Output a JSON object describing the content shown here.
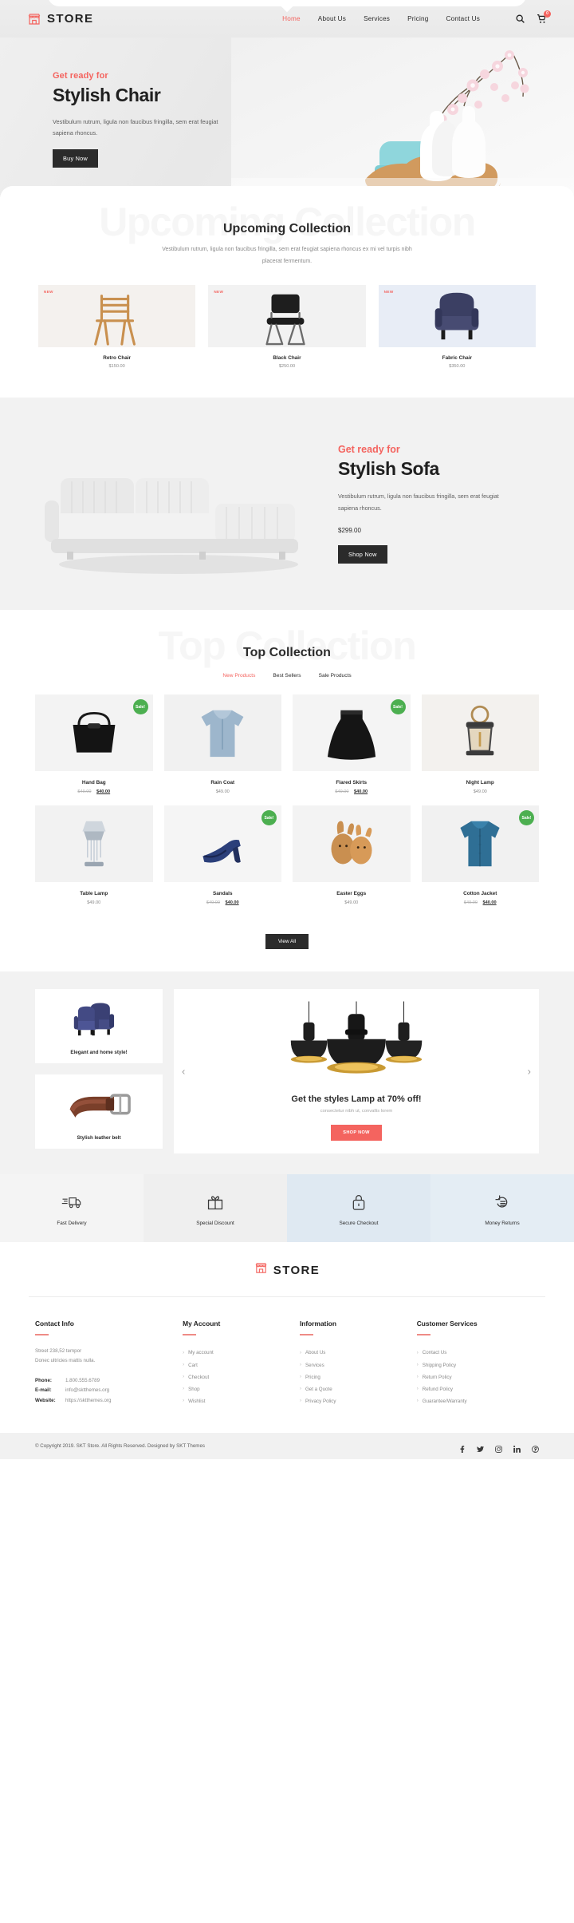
{
  "header": {
    "brand": "STORE",
    "brand_icon": "storefront-icon",
    "nav": [
      {
        "label": "Home",
        "active": true
      },
      {
        "label": "About Us",
        "active": false
      },
      {
        "label": "Services",
        "active": false
      },
      {
        "label": "Pricing",
        "active": false
      },
      {
        "label": "Contact Us",
        "active": false
      }
    ],
    "search_icon": "search-icon",
    "cart_icon": "cart-icon",
    "cart_count": "0"
  },
  "hero": {
    "eyebrow": "Get ready for",
    "title": "Stylish Chair",
    "description": "Vestibulum rutrum, ligula non faucibus fringilla, sem erat feugiat sapiena rhoncus.",
    "button": "Buy Now"
  },
  "upcoming": {
    "ghost_title": "Upcoming Collection",
    "title": "Upcoming Collection",
    "description": "Vestibulum rutrum, ligula non faucibus fringilla, sem erat feugiat sapiena rhoncus ex mi vel turpis nibh placerat fermentum.",
    "badge": "NEW",
    "products": [
      {
        "name": "Retro Chair",
        "price": "$150.00",
        "bg": "#f4f1ee"
      },
      {
        "name": "Black Chair",
        "price": "$250.00",
        "bg": "#f2f2f2"
      },
      {
        "name": "Fabric Chair",
        "price": "$350.00",
        "bg": "#e8edf6"
      }
    ]
  },
  "sofa": {
    "eyebrow": "Get ready for",
    "title": "Stylish Sofa",
    "description": "Vestibulum rutrum, ligula non faucibus fringilla, sem erat feugiat sapiena rhoncus.",
    "price": "$299.00",
    "button": "Shop Now"
  },
  "top_collection": {
    "ghost_title": "Top Collection",
    "title": "Top Collection",
    "tabs": [
      {
        "label": "New Products",
        "active": true
      },
      {
        "label": "Best Sellers",
        "active": false
      },
      {
        "label": "Sale Products",
        "active": false
      }
    ],
    "sale_badge": "Sale!",
    "products": [
      {
        "name": "Hand Bag",
        "old_price": "$49.00",
        "price": "$40.00",
        "sale": true,
        "art": "handbag"
      },
      {
        "name": "Rain Coat",
        "old_price": "",
        "price": "$49.00",
        "sale": false,
        "art": "raincoat"
      },
      {
        "name": "Flared Skirts",
        "old_price": "$49.00",
        "price": "$40.00",
        "sale": true,
        "art": "skirt"
      },
      {
        "name": "Night Lamp",
        "old_price": "",
        "price": "$49.00",
        "sale": false,
        "art": "lantern"
      },
      {
        "name": "Table Lamp",
        "old_price": "",
        "price": "$49.00",
        "sale": false,
        "art": "tablelamp"
      },
      {
        "name": "Sandals",
        "old_price": "$49.00",
        "price": "$40.00",
        "sale": true,
        "art": "sandal"
      },
      {
        "name": "Easter Eggs",
        "old_price": "",
        "price": "$49.00",
        "sale": false,
        "art": "eggs"
      },
      {
        "name": "Cotton Jacket",
        "old_price": "$49.00",
        "price": "$40.00",
        "sale": true,
        "art": "jacket"
      }
    ],
    "view_all": "View All"
  },
  "promo": {
    "mini": [
      {
        "caption": "Elegant and home style!",
        "art": "armchairs"
      },
      {
        "caption": "Stylish leather belt",
        "art": "belt"
      }
    ],
    "prev_arrow": "‹",
    "next_arrow": "›",
    "title": "Get the styles Lamp at 70% off!",
    "subtitle": "consectetur nibh ut, convallis lorem",
    "button": "SHOP NOW"
  },
  "features": [
    {
      "label": "Fast Delivery",
      "icon": "truck-icon"
    },
    {
      "label": "Special Discount",
      "icon": "gift-icon"
    },
    {
      "label": "Secure Checkout",
      "icon": "lock-icon"
    },
    {
      "label": "Money Returns",
      "icon": "money-return-icon"
    }
  ],
  "footer": {
    "brand": "STORE",
    "contact": {
      "title": "Contact Info",
      "address_lines": [
        "Street 238,52 tempor",
        "Donec ultricies mattis nulla."
      ],
      "rows": [
        {
          "key": "Phone:",
          "value": "1.800.555.6789"
        },
        {
          "key": "E-mail:",
          "value": "info@sktthemes.org"
        },
        {
          "key": "Website:",
          "value": "https://sktthemes.org"
        }
      ]
    },
    "columns": [
      {
        "title": "My Account",
        "links": [
          "My account",
          "Cart",
          "Checkout",
          "Shop",
          "Wishlist"
        ]
      },
      {
        "title": "Information",
        "links": [
          "About Us",
          "Services",
          "Pricing",
          "Get a Quote",
          "Privacy Policy"
        ]
      },
      {
        "title": "Customer Services",
        "links": [
          "Contact Us",
          "Shipping Policy",
          "Return Policy",
          "Refund Policy",
          "Guarantee/Warranty"
        ]
      }
    ],
    "copyright": "© Copyright 2019. SKT Store. All Rights Reserved. Designed by SKT Themes",
    "socials": [
      "facebook-icon",
      "twitter-icon",
      "instagram-icon",
      "linkedin-icon",
      "pinterest-icon"
    ]
  },
  "colors": {
    "accent": "#f4645f",
    "dark": "#2b2b2b",
    "sale_green": "#4caf50",
    "muted": "#8a8a8a"
  }
}
